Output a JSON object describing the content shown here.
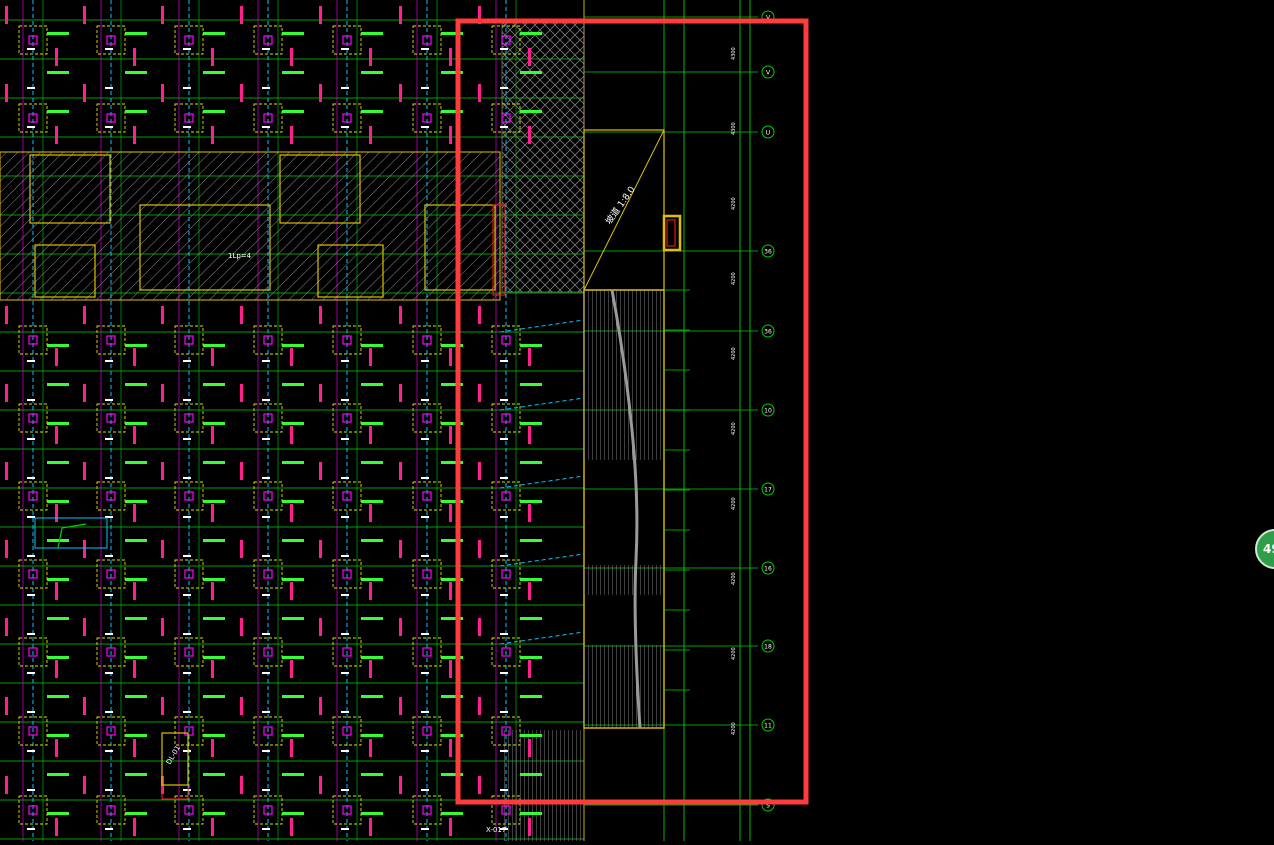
{
  "app": {
    "view": "cad-drawing-viewer",
    "background": "#000000"
  },
  "colors": {
    "grid_line": "#00d000",
    "axis_line": "#22e022",
    "dim_text": "#ff1f8e",
    "beam_label": "#33ff33",
    "column_box": "#e0e000",
    "magenta": "#ff00ff",
    "cyan": "#00c8ff",
    "wall_yellow": "#e0c000",
    "hatch": "#7a7a7a",
    "highlight": "#ff3b3b",
    "white": "#ffffff"
  },
  "drawing": {
    "column_grid": {
      "x_axes": [
        33,
        111,
        189,
        268,
        347,
        427,
        506
      ],
      "y_rows": [
        40,
        118,
        340,
        418,
        496,
        574,
        652,
        731,
        810
      ]
    },
    "axis_bubbles": [
      {
        "label": "V",
        "row": 17
      },
      {
        "label": "V",
        "row": 72
      },
      {
        "label": "U",
        "row": 132
      },
      {
        "label": "36",
        "row": 251
      },
      {
        "label": "36",
        "row": 331
      },
      {
        "label": "10",
        "row": 410
      },
      {
        "label": "17",
        "row": 489
      },
      {
        "label": "16",
        "row": 568
      },
      {
        "label": "18",
        "row": 646
      },
      {
        "label": "11",
        "row": 725
      },
      {
        "label": "S",
        "row": 805
      }
    ],
    "dimension_values": [
      "4300",
      "4300",
      "4200",
      "4200",
      "4200",
      "4200",
      "4200",
      "4200",
      "4200",
      "4200"
    ],
    "ramp_label": "坡道 1:8.0",
    "column_label": "1Lp=4",
    "bottom_note": "X-017",
    "small_tag": "DL-01"
  },
  "highlight_box": {
    "label": "selection-highlight"
  },
  "badge": {
    "text": "49"
  }
}
